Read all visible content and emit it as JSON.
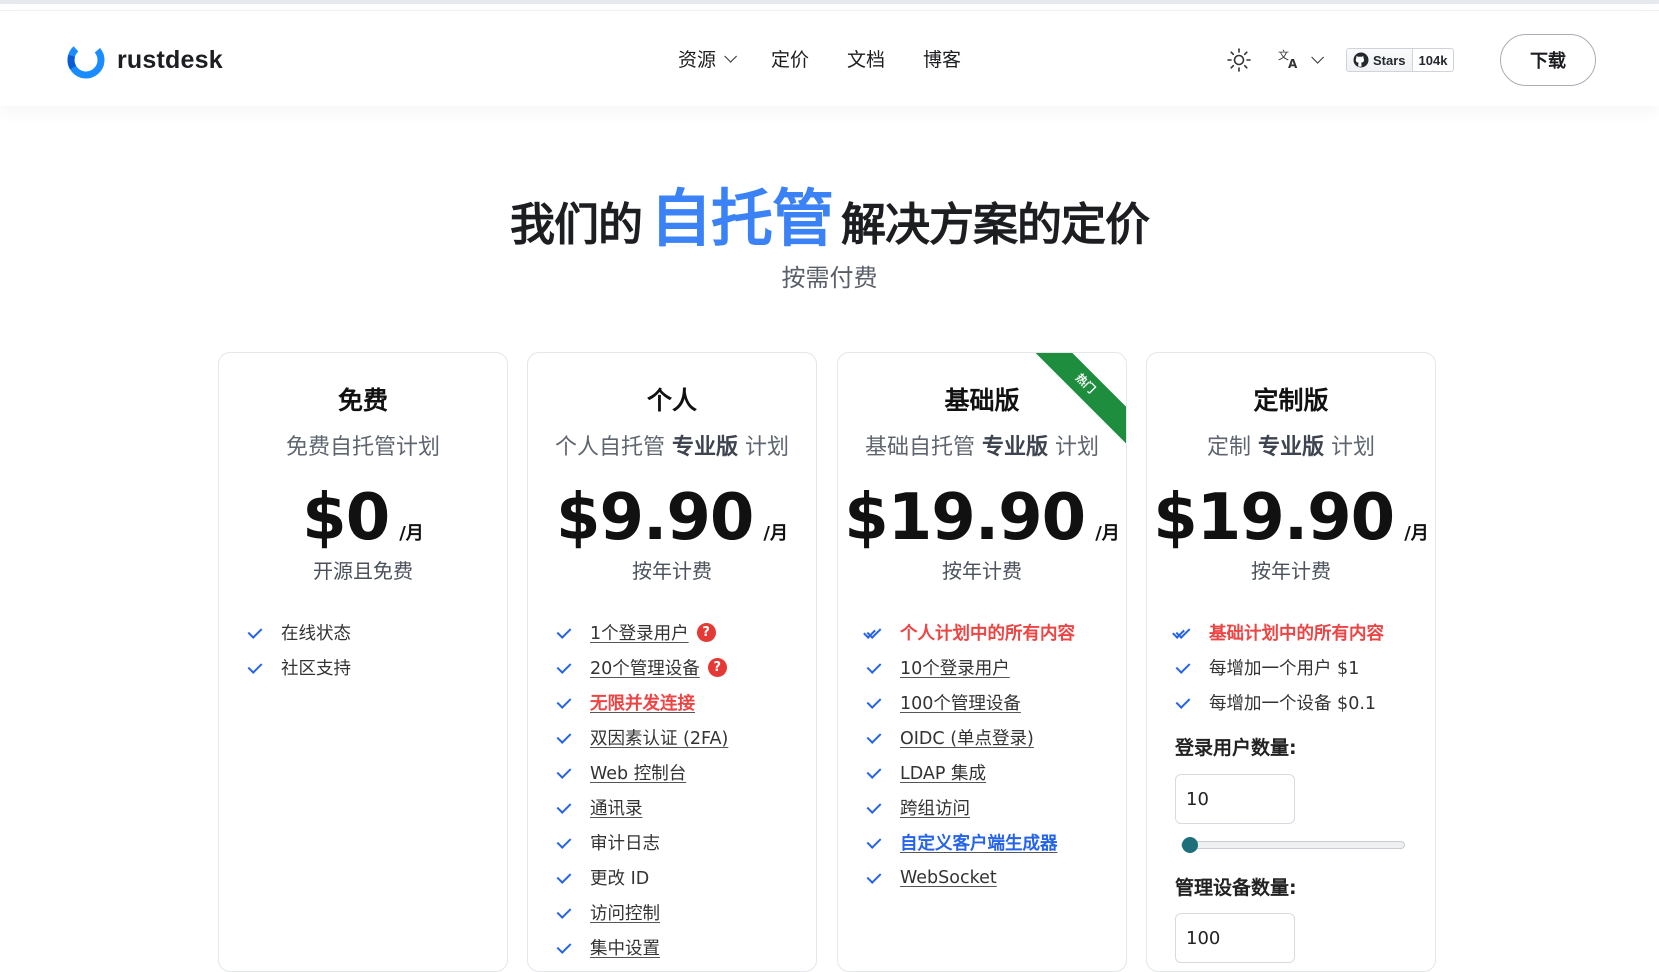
{
  "nav": {
    "brand": "rustdesk",
    "links": [
      {
        "label": "资源",
        "dropdown": true
      },
      {
        "label": "定价"
      },
      {
        "label": "文档"
      },
      {
        "label": "博客"
      }
    ],
    "github": {
      "stars_label": "Stars",
      "count": "104k"
    },
    "download_label": "下载"
  },
  "hero": {
    "title_prefix": "我们的",
    "title_highlight": "自托管",
    "title_suffix": "解决方案的定价",
    "subtitle": "按需付费"
  },
  "colors": {
    "accent": "#3b82f6",
    "red": "#ef4444",
    "ribbon": "#1e8e3e",
    "check": "#2563eb"
  },
  "plans": [
    {
      "title": "免费",
      "subtitle_pre": "免费自托管计划",
      "subtitle_bold": "",
      "subtitle_post": "",
      "price": "$0",
      "period": "/月",
      "billing": "开源且免费",
      "features": [
        {
          "text": "在线状态"
        },
        {
          "text": "社区支持"
        }
      ]
    },
    {
      "title": "个人",
      "subtitle_pre": "个人自托管 ",
      "subtitle_bold": "专业版",
      "subtitle_post": " 计划",
      "price": "$9.90",
      "period": "/月",
      "billing": "按年计费",
      "features": [
        {
          "text": "1个登录用户",
          "help": "?"
        },
        {
          "text": "20个管理设备",
          "help": "?"
        },
        {
          "text": "无限并发连接"
        },
        {
          "text": "双因素认证 (2FA)"
        },
        {
          "text": "Web 控制台"
        },
        {
          "text": "通讯录"
        },
        {
          "text": "审计日志"
        },
        {
          "text": "更改 ID"
        },
        {
          "text": "访问控制"
        },
        {
          "text": "集中设置"
        }
      ]
    },
    {
      "title": "基础版",
      "subtitle_pre": "基础自托管 ",
      "subtitle_bold": "专业版",
      "subtitle_post": " 计划",
      "price": "$19.90",
      "period": "/月",
      "billing": "按年计费",
      "ribbon": "热门",
      "features": [
        {
          "text": "个人计划中的所有内容"
        },
        {
          "text": "10个登录用户"
        },
        {
          "text": "100个管理设备"
        },
        {
          "text": "OIDC (单点登录)"
        },
        {
          "text": "LDAP 集成"
        },
        {
          "text": "跨组访问"
        },
        {
          "text": "自定义客户端生成器"
        },
        {
          "text": "WebSocket"
        }
      ]
    },
    {
      "title": "定制版",
      "subtitle_pre": "定制 ",
      "subtitle_bold": "专业版",
      "subtitle_post": " 计划",
      "price": "$19.90",
      "period": "/月",
      "billing": "按年计费",
      "features": [
        {
          "text": "基础计划中的所有内容"
        },
        {
          "text": "每增加一个用户 $1"
        },
        {
          "text": "每增加一个设备 $0.1"
        }
      ],
      "users_label": "登录用户数量:",
      "users_value": "10",
      "users_slider_fraction": 0,
      "devices_label": "管理设备数量:",
      "devices_value": "100"
    }
  ]
}
